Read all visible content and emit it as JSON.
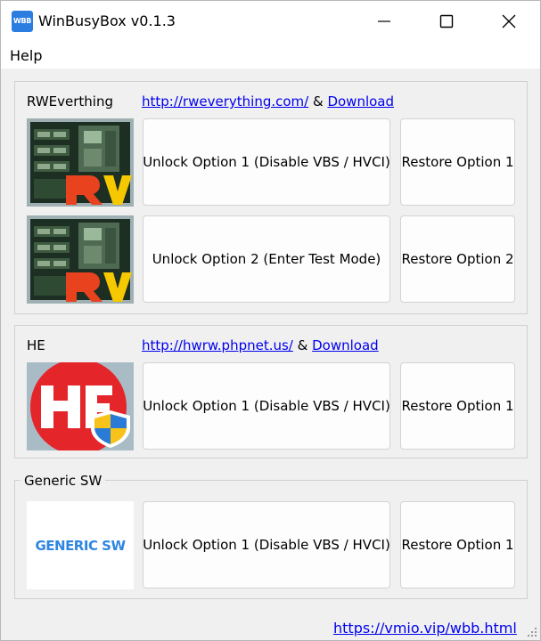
{
  "window": {
    "title": "WinBusyBox v0.1.3",
    "icon_text": "WBB"
  },
  "menu": {
    "items": [
      {
        "label": "Help"
      }
    ]
  },
  "groups": [
    {
      "label": "RWEverthing",
      "link_url": "http://rweverything.com/",
      "link_sep": " & ",
      "download_label": "Download",
      "rows": [
        {
          "unlock_label": "Unlock Option 1 (Disable VBS / HVCI)",
          "restore_label": "Restore Option 1"
        },
        {
          "unlock_label": "Unlock Option 2 (Enter Test Mode)",
          "restore_label": "Restore Option 2"
        }
      ]
    },
    {
      "label": "HE",
      "link_url": "http://hwrw.phpnet.us/",
      "link_sep": " & ",
      "download_label": "Download",
      "rows": [
        {
          "unlock_label": "Unlock Option 1 (Disable VBS / HVCI)",
          "restore_label": "Restore Option 1"
        }
      ]
    },
    {
      "label": "Generic SW",
      "logo_text": "GENERIC SW",
      "rows": [
        {
          "unlock_label": "Unlock Option 1 (Disable VBS / HVCI)",
          "restore_label": "Restore Option 1"
        }
      ]
    }
  ],
  "footer": {
    "link": "https://vmio.vip/wbb.html"
  },
  "colors": {
    "link": "#0000ee",
    "he_red": "#e4252a",
    "generic_blue": "#2f86e0"
  }
}
